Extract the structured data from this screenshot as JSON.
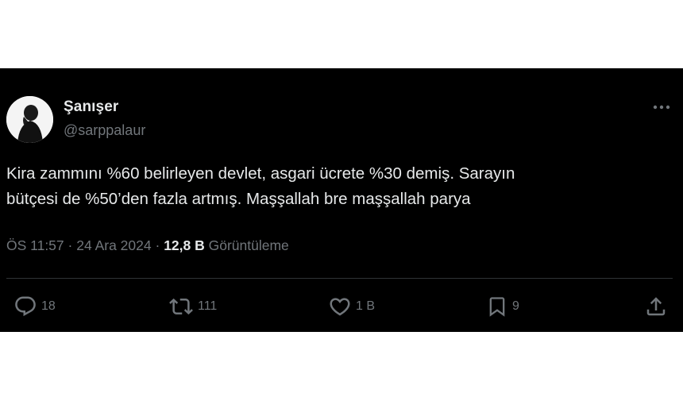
{
  "tweet": {
    "author": {
      "display_name": "Şanışer",
      "handle": "@sarppalaur",
      "avatar_icon": "avatar-silhouette-icon"
    },
    "more_icon": "more-dots-icon",
    "text": "Kira zammını %60 belirleyen devlet, asgari ücrete %30 demiş. Sarayın\nbütçesi de %50’den fazla artmış. Maşşallah bre maşşallah parya",
    "meta": {
      "time": "ÖS 11:57",
      "separator": "·",
      "date": "24 Ara 2024",
      "views_count": "12,8 B",
      "views_label": "Görüntüleme"
    },
    "actions": {
      "reply": {
        "icon": "reply-icon",
        "count": "18"
      },
      "retweet": {
        "icon": "retweet-icon",
        "count": "111"
      },
      "like": {
        "icon": "heart-icon",
        "count": "1 B"
      },
      "bookmark": {
        "icon": "bookmark-icon",
        "count": "9"
      },
      "share": {
        "icon": "share-icon"
      }
    }
  },
  "colors": {
    "background": "#000000",
    "text_primary": "#e7e9ea",
    "text_secondary": "#71767b",
    "divider": "#2f3336"
  }
}
